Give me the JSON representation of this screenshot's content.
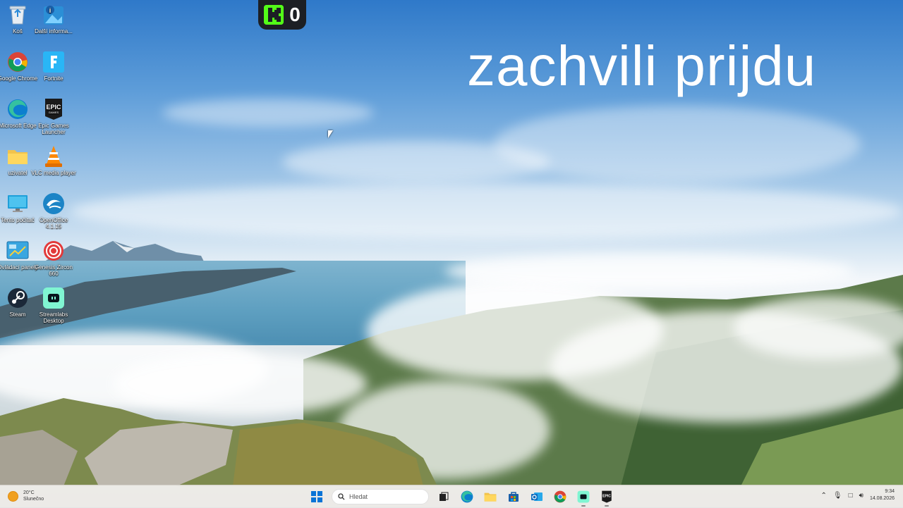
{
  "overlay": {
    "text": "zachvili prijdu"
  },
  "kick": {
    "viewer_count": "0",
    "accent": "#53fc18"
  },
  "desktop_icons": [
    {
      "label": "Koš",
      "icon": "recycle-bin-icon"
    },
    {
      "label": "Další informa...",
      "icon": "info-photo-icon"
    },
    {
      "label": "Google Chrome",
      "icon": "chrome-icon"
    },
    {
      "label": "Fortnite",
      "icon": "fortnite-icon"
    },
    {
      "label": "Microsoft Edge",
      "icon": "edge-icon"
    },
    {
      "label": "Epic Games Launcher",
      "icon": "epic-games-icon"
    },
    {
      "label": "uzivatel",
      "icon": "folder-icon"
    },
    {
      "label": "VLC media player",
      "icon": "vlc-icon"
    },
    {
      "label": "Tento počítač",
      "icon": "monitor-icon"
    },
    {
      "label": "OpenOffice 4.1.15",
      "icon": "openoffice-icon"
    },
    {
      "label": "Ovládací panely",
      "icon": "control-panel-icon"
    },
    {
      "label": "Genesis Zircon 660",
      "icon": "genesis-mouse-icon"
    },
    {
      "label": "Steam",
      "icon": "steam-icon"
    },
    {
      "label": "Streamlabs Desktop",
      "icon": "streamlabs-icon"
    }
  ],
  "taskbar": {
    "weather_temp": "20°C",
    "weather_desc": "Slunečno",
    "search_placeholder": "Hledat",
    "time": "9:34",
    "date": "14.08.2026"
  }
}
